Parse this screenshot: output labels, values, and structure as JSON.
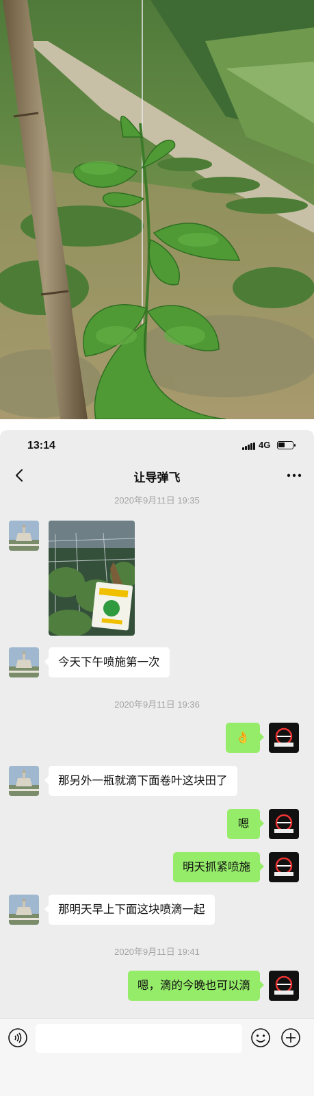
{
  "status_bar": {
    "time": "13:14",
    "network": "4G"
  },
  "chat": {
    "title": "让导弹飞",
    "contact_avatar_icon": "castle-landscape-avatar",
    "self_avatar_icon": "black-logo-avatar",
    "bubble_in_color": "#ffffff",
    "bubble_out_color": "#95ec69"
  },
  "timestamps": [
    "2020年9月11日 19:35",
    "2020年9月11日 19:36",
    "2020年9月11日 19:41"
  ],
  "messages": [
    {
      "from": "contact",
      "type": "image",
      "content": "field-photo-with-pesticide-bag"
    },
    {
      "from": "contact",
      "type": "text",
      "text": "今天下午喷施第一次"
    },
    {
      "from": "me",
      "type": "text",
      "text": "👌"
    },
    {
      "from": "contact",
      "type": "text",
      "text": "那另外一瓶就滴下面卷叶这块田了"
    },
    {
      "from": "me",
      "type": "text",
      "text": "嗯"
    },
    {
      "from": "me",
      "type": "text",
      "text": "明天抓紧喷施"
    },
    {
      "from": "contact",
      "type": "text",
      "text": "那明天早上下面这块喷滴一起"
    },
    {
      "from": "me",
      "type": "text",
      "text": "嗯，滴的今晚也可以滴"
    }
  ],
  "input_bar": {
    "placeholder": ""
  }
}
